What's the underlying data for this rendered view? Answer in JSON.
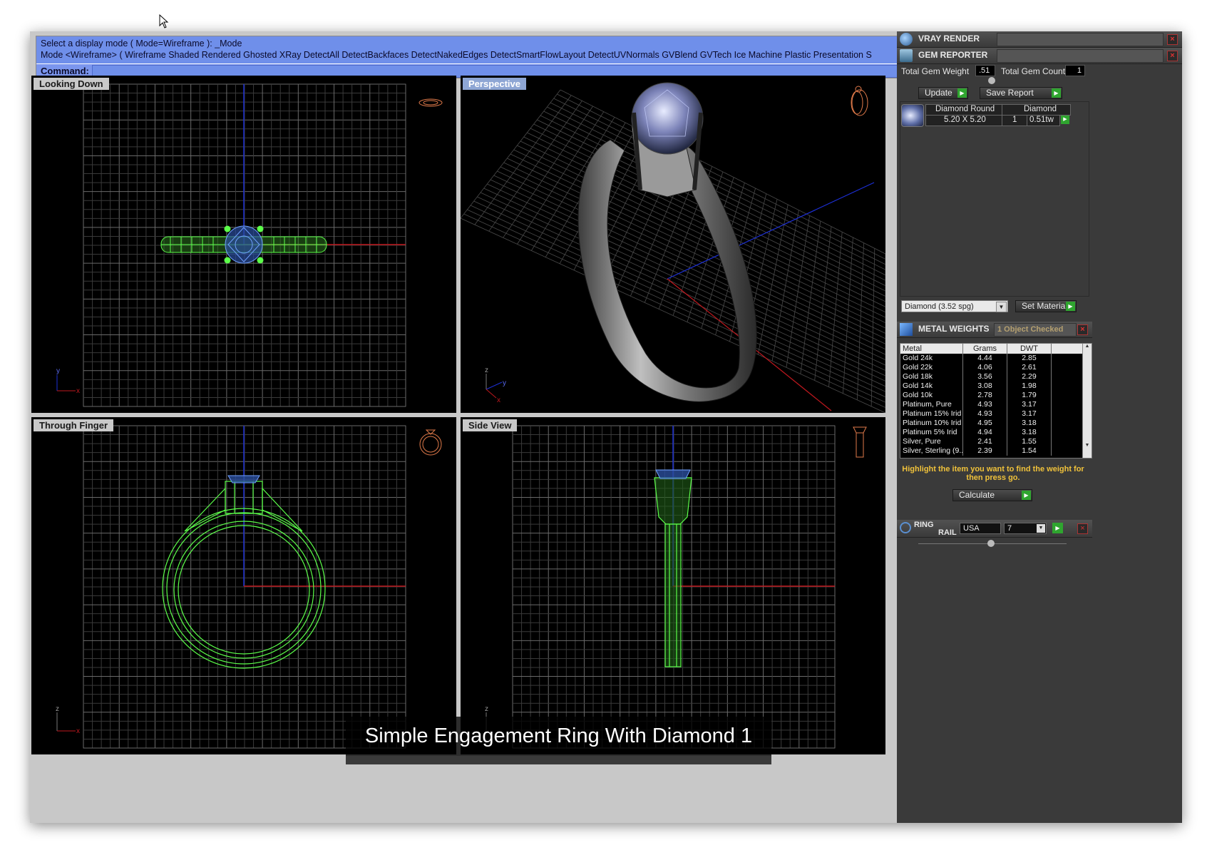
{
  "command_area": {
    "history_line1": "Select a display mode ( Mode=Wireframe ): _Mode",
    "history_line2": "Mode <Wireframe> ( Wireframe  Shaded  Rendered  Ghosted  XRay  DetectAll  DetectBackfaces  DetectNakedEdges  DetectSmartFlowLayout  DetectUVNormals  GVBlend  GVTech  Ice  Machine  Plastic  Presentation  S",
    "command_label": "Command:",
    "command_value": ""
  },
  "viewports": {
    "top_left": {
      "label": "Looking Down"
    },
    "top_right": {
      "label": "Perspective"
    },
    "bottom_left": {
      "label": "Through Finger"
    },
    "bottom_right": {
      "label": "Side View"
    }
  },
  "axis_labels": {
    "x": "x",
    "y": "y",
    "z": "z"
  },
  "caption": "Simple Engagement Ring With Diamond 1",
  "panel": {
    "vray": {
      "title": "VRAY RENDER"
    },
    "gem_reporter": {
      "title": "GEM REPORTER",
      "total_weight_label": "Total Gem Weight",
      "total_weight_value": ".51",
      "total_count_label": "Total Gem Count",
      "total_count_value": "1",
      "update_button": "Update",
      "save_report_button": "Save Report",
      "gem": {
        "shape": "Diamond Round",
        "size": "5.20 X 5.20",
        "material": "Diamond",
        "count": "1",
        "weight": "0.51tw"
      },
      "material_select": "Diamond    (3.52 spg)",
      "set_material_button": "Set Material"
    },
    "metal_weights": {
      "title": "METAL WEIGHTS",
      "status": "1 Object Checked",
      "columns": [
        "Metal",
        "Grams",
        "DWT"
      ],
      "rows": [
        {
          "metal": "Gold 24k",
          "grams": "4.44",
          "dwt": "2.85"
        },
        {
          "metal": "Gold 22k",
          "grams": "4.06",
          "dwt": "2.61"
        },
        {
          "metal": "Gold 18k",
          "grams": "3.56",
          "dwt": "2.29"
        },
        {
          "metal": "Gold 14k",
          "grams": "3.08",
          "dwt": "1.98"
        },
        {
          "metal": "Gold 10k",
          "grams": "2.78",
          "dwt": "1.79"
        },
        {
          "metal": "Platinum, Pure",
          "grams": "4.93",
          "dwt": "3.17"
        },
        {
          "metal": "Platinum 15% Irid",
          "grams": "4.93",
          "dwt": "3.17"
        },
        {
          "metal": "Platinum 10% Irid",
          "grams": "4.95",
          "dwt": "3.18"
        },
        {
          "metal": "Platinum 5% Irid",
          "grams": "4.94",
          "dwt": "3.18"
        },
        {
          "metal": "Silver, Pure",
          "grams": "2.41",
          "dwt": "1.55"
        },
        {
          "metal": "Silver, Sterling (9...",
          "grams": "2.39",
          "dwt": "1.54"
        }
      ],
      "hint": "Highlight the item you want to find the weight for then press go.",
      "calculate_button": "Calculate"
    },
    "ring_rail": {
      "title_line1": "RING",
      "title_line2": "RAIL",
      "region": "USA",
      "size": "7"
    }
  },
  "colors": {
    "wireframe": "#5cff4a",
    "gem": "#6fa0ff",
    "grid": "#3a3a3a",
    "axis_x": "#c0181e",
    "axis_y": "#1c2fd6",
    "accent_go": "#2fa52f",
    "hint_text": "#f0c23a"
  }
}
